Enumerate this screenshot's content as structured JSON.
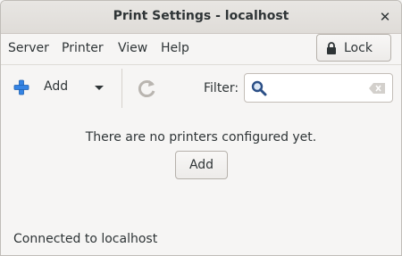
{
  "window": {
    "title": "Print Settings - localhost",
    "close_glyph": "✕"
  },
  "menubar": {
    "items": [
      "Server",
      "Printer",
      "View",
      "Help"
    ],
    "lock_label": "Lock"
  },
  "toolbar": {
    "add_label": "Add",
    "filter_label": "Filter:",
    "filter_value": "",
    "icons": {
      "add": "plus-icon",
      "dropdown": "chevron-down-icon",
      "refresh": "refresh-icon",
      "search": "search-icon",
      "clear": "clear-icon"
    }
  },
  "main": {
    "empty_message": "There are no printers configured yet.",
    "add_button_label": "Add"
  },
  "statusbar": {
    "text": "Connected to localhost"
  },
  "colors": {
    "window_bg": "#f6f5f4",
    "titlebar": "#dfdcd8",
    "accent_blue": "#3584e4",
    "text": "#2e3436"
  }
}
